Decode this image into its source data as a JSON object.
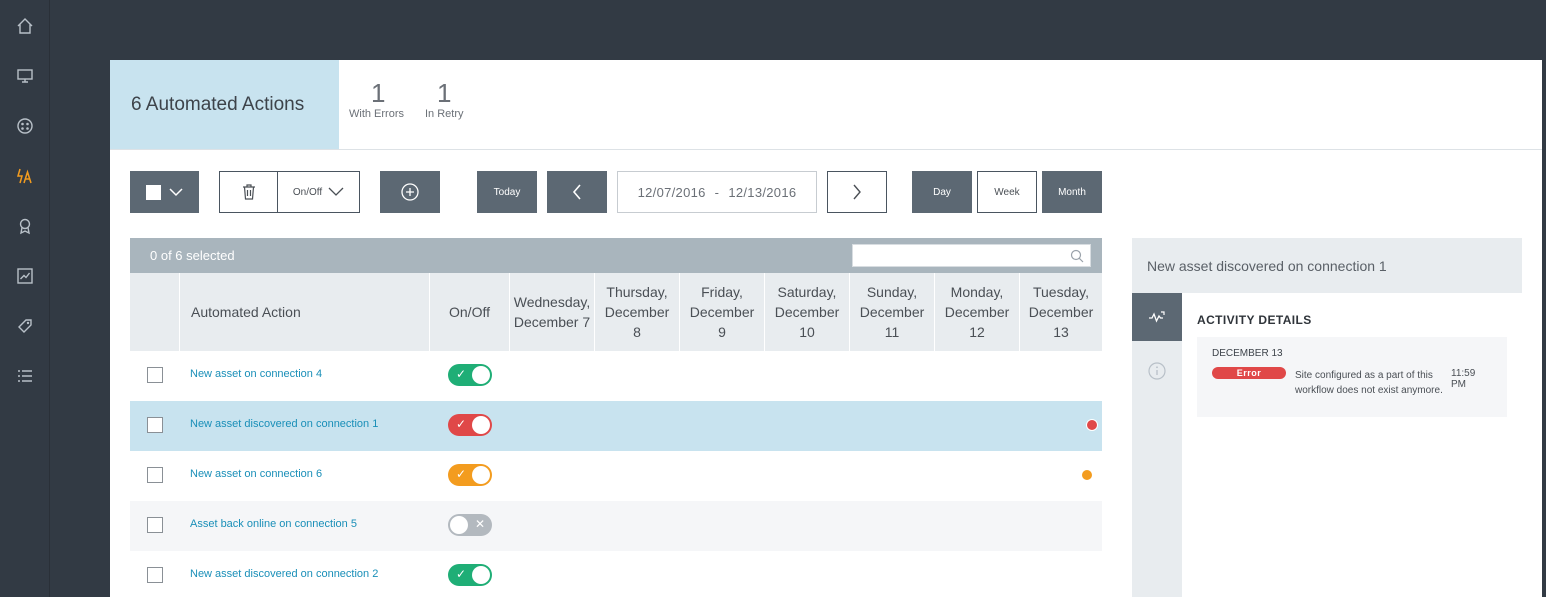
{
  "nav": {
    "items": [
      {
        "icon": "home-icon",
        "active": false
      },
      {
        "icon": "monitor-icon",
        "active": false
      },
      {
        "icon": "dashboard-icon",
        "active": false
      },
      {
        "icon": "automation-icon",
        "active": true
      },
      {
        "icon": "award-icon",
        "active": false
      },
      {
        "icon": "chart-icon",
        "active": false
      },
      {
        "icon": "tag-icon",
        "active": false
      },
      {
        "icon": "list-icon",
        "active": false
      }
    ]
  },
  "header": {
    "title": "6 Automated Actions",
    "stats": [
      {
        "value": "1",
        "label": "With Errors"
      },
      {
        "value": "1",
        "label": "In Retry"
      }
    ]
  },
  "toolbar": {
    "onoff_label": "On/Off",
    "today_label": "Today",
    "date_start": "12/07/2016",
    "date_sep": "-",
    "date_end": "12/13/2016",
    "view_day": "Day",
    "view_week": "Week",
    "view_month": "Month"
  },
  "table": {
    "selected_text": "0 of 6 selected",
    "search_placeholder": "",
    "columns": {
      "name": "Automated Action",
      "onoff": "On/Off",
      "days": [
        [
          "Wednesday,",
          "December 7"
        ],
        [
          "Thursday,",
          "December",
          "8"
        ],
        [
          "Friday,",
          "December",
          "9"
        ],
        [
          "Saturday,",
          "December",
          "10"
        ],
        [
          "Sunday,",
          "December",
          "11"
        ],
        [
          "Monday,",
          "December",
          "12"
        ],
        [
          "Tuesday,",
          "December",
          "13"
        ]
      ]
    },
    "rows": [
      {
        "name": "New asset on connection 4",
        "state": "on",
        "color": "#1fae76",
        "dot": null
      },
      {
        "name": "New asset discovered on connection 1",
        "state": "on",
        "color": "#e04848",
        "dot": "#e04848"
      },
      {
        "name": "New asset on connection 6",
        "state": "on",
        "color": "#f39c1f",
        "dot": "#f39c1f"
      },
      {
        "name": "Asset back online on connection 5",
        "state": "off",
        "color": "#b3b9bf",
        "dot": null
      },
      {
        "name": "New asset discovered on connection 2",
        "state": "on",
        "color": "#1fae76",
        "dot": null
      }
    ]
  },
  "panel": {
    "title": "New asset discovered on connection 1",
    "activity_heading": "ACTIVITY DETAILS",
    "entry": {
      "date": "DECEMBER 13",
      "badge": "Error",
      "message": "Site configured as a part of this workflow does not exist anymore.",
      "time": "11:59 PM"
    }
  },
  "colors": {
    "accent": "#1a8fb8",
    "error": "#e04848",
    "warning": "#f39c1f",
    "success": "#1fae76",
    "nav_active": "#f39c1f"
  }
}
